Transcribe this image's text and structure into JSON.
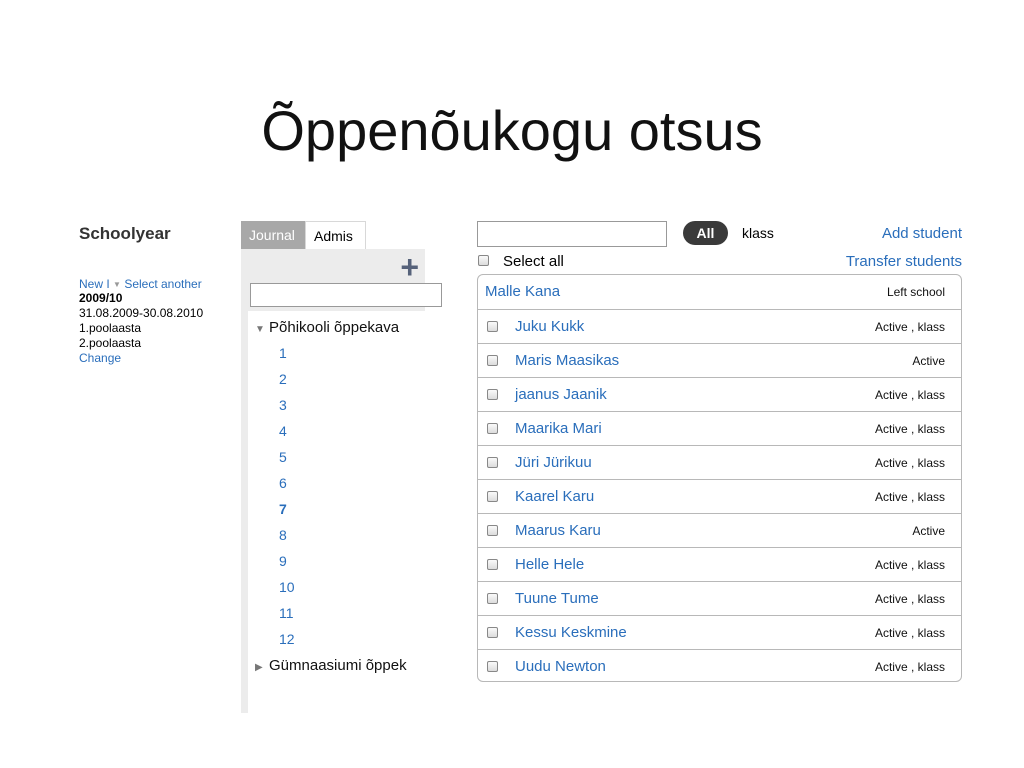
{
  "slide": {
    "title": "Õppenõukogu otsus"
  },
  "schoolyear": {
    "heading": "Schoolyear",
    "new_label": "New",
    "separator": "I",
    "select_another": "Select another",
    "year": "2009/10",
    "range": "31.08.2009-30.08.2010",
    "period1": "1.poolaasta",
    "period2": "2.poolaasta",
    "change": "Change"
  },
  "tree": {
    "tabs": [
      "Journal",
      "Admis"
    ],
    "plus": "+",
    "nodes": [
      {
        "label": "Põhikooli õppekava",
        "expanded": true
      },
      {
        "label": "Gümnaasiumi õppek",
        "expanded": false
      }
    ],
    "grades": [
      "1",
      "2",
      "3",
      "4",
      "5",
      "6",
      "7",
      "8",
      "9",
      "10",
      "11",
      "12"
    ]
  },
  "toolbar": {
    "search_placeholder": "",
    "all_button": "All",
    "klass_label": "klass",
    "add_student": "Add student",
    "select_all": "Select all",
    "transfer_students": "Transfer students"
  },
  "students": [
    {
      "name": "Malle Kana",
      "status": "Left school",
      "checkbox": false
    },
    {
      "name": "Juku Kukk",
      "status": "Active , klass",
      "checkbox": true
    },
    {
      "name": "Maris Maasikas",
      "status": "Active",
      "checkbox": true
    },
    {
      "name": "jaanus Jaanik",
      "status": "Active , klass",
      "checkbox": true
    },
    {
      "name": "Maarika Mari",
      "status": "Active , klass",
      "checkbox": true
    },
    {
      "name": "Jüri Jürikuu",
      "status": "Active , klass",
      "checkbox": true
    },
    {
      "name": "Kaarel Karu",
      "status": "Active , klass",
      "checkbox": true
    },
    {
      "name": "Maarus Karu",
      "status": "Active",
      "checkbox": true
    },
    {
      "name": "Helle Hele",
      "status": "Active , klass",
      "checkbox": true
    },
    {
      "name": "Tuune Tume",
      "status": "Active , klass",
      "checkbox": true
    },
    {
      "name": "Kessu Keskmine",
      "status": "Active , klass",
      "checkbox": true
    },
    {
      "name": "Uudu Newton",
      "status": "Active , klass",
      "checkbox": true
    }
  ],
  "colors": {
    "link": "#2a6ebb",
    "all_button_bg": "#3a3a3a",
    "tab_inactive": "#a8a8a8"
  }
}
